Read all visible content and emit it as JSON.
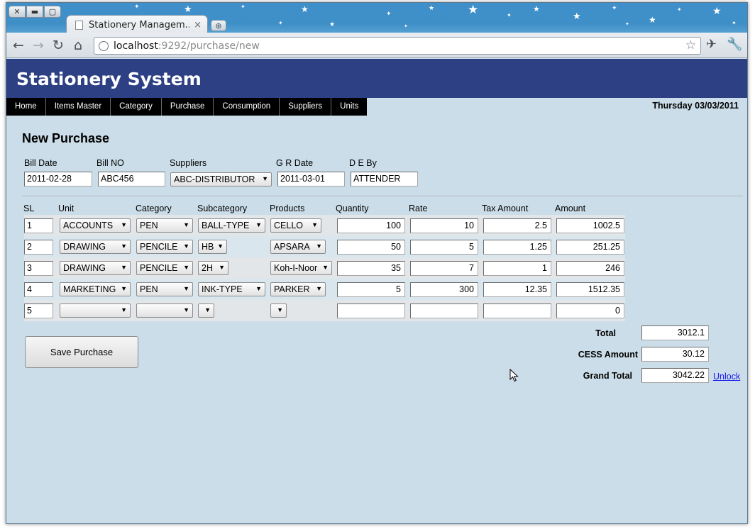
{
  "browser": {
    "tab_title": "Stationery Managem...",
    "tab_close": "×",
    "url_host": "localhost",
    "url_path": ":9292/purchase/new"
  },
  "app": {
    "title": "Stationery System",
    "date": "Thursday 03/03/2011",
    "menu": [
      "Home",
      "Items Master",
      "Category",
      "Purchase",
      "Consumption",
      "Suppliers",
      "Units"
    ]
  },
  "form": {
    "heading": "New Purchase",
    "bill_date_label": "Bill Date",
    "bill_date": "2011-02-28",
    "bill_no_label": "Bill NO",
    "bill_no": "ABC456",
    "suppliers_label": "Suppliers",
    "supplier": "ABC-DISTRIBUTOR",
    "gr_date_label": "G R Date",
    "gr_date": "2011-03-01",
    "de_by_label": "D E By",
    "de_by": "ATTENDER"
  },
  "table": {
    "columns": [
      "SL",
      "Unit",
      "Category",
      "Subcategory",
      "Products",
      "Quantity",
      "Rate",
      "Tax Amount",
      "Amount"
    ],
    "rows": [
      {
        "sl": "1",
        "unit": "ACCOUNTS",
        "category": "PEN",
        "subcategory": "BALL-TYPE",
        "product": "CELLO",
        "quantity": "100",
        "rate": "10",
        "tax": "2.5",
        "amount": "1002.5"
      },
      {
        "sl": "2",
        "unit": "DRAWING",
        "category": "PENCILE",
        "subcategory": "HB",
        "product": "APSARA",
        "quantity": "50",
        "rate": "5",
        "tax": "1.25",
        "amount": "251.25"
      },
      {
        "sl": "3",
        "unit": "DRAWING",
        "category": "PENCILE",
        "subcategory": "2H",
        "product": "Koh-I-Noor",
        "quantity": "35",
        "rate": "7",
        "tax": "1",
        "amount": "246"
      },
      {
        "sl": "4",
        "unit": "MARKETING",
        "category": "PEN",
        "subcategory": "INK-TYPE",
        "product": "PARKER",
        "quantity": "5",
        "rate": "300",
        "tax": "12.35",
        "amount": "1512.35"
      },
      {
        "sl": "5",
        "unit": "",
        "category": "",
        "subcategory": "",
        "product": "",
        "quantity": "",
        "rate": "",
        "tax": "",
        "amount": "0"
      }
    ]
  },
  "totals": {
    "total_label": "Total",
    "total": "3012.1",
    "cess_label": "CESS Amount",
    "cess": "30.12",
    "grand_label": "Grand Total",
    "grand": "3042.22",
    "unlock": "Unlock"
  },
  "save_button": "Save Purchase",
  "icons": {
    "dropdown_arrow": "▼"
  }
}
